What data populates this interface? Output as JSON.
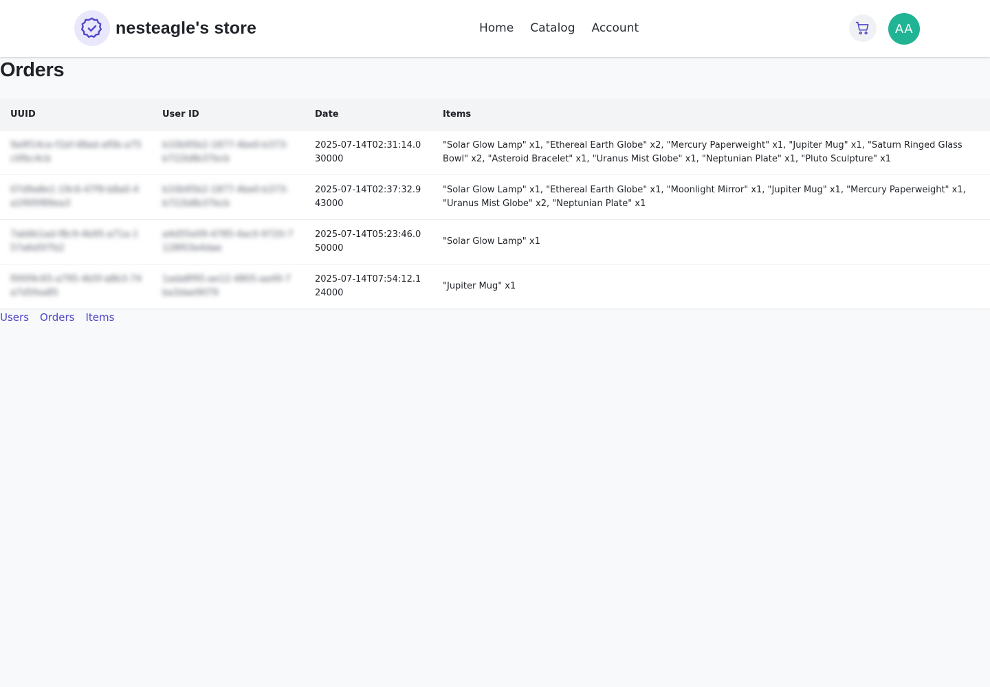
{
  "header": {
    "store_name": "nesteagle's store",
    "nav": [
      {
        "label": "Home"
      },
      {
        "label": "Catalog"
      },
      {
        "label": "Account"
      }
    ],
    "avatar_initials": "AA",
    "icons": {
      "logo": "verified-badge-icon",
      "cart": "cart-icon"
    },
    "colors": {
      "accent": "#4f46c9",
      "avatar_bg": "#20b494"
    }
  },
  "page": {
    "title": "Orders"
  },
  "table": {
    "columns": [
      "UUID",
      "User ID",
      "Date",
      "Items"
    ],
    "rows": [
      {
        "uuid": "9a9f14ce-f1bf-48ad-af0b-a75c0fbc4cb",
        "user_id": "b10b95b2-1877-4be0-b373-b722b8b37bcb",
        "date": "2025-07-14T02:31:14.030000",
        "items": "\"Solar Glow Lamp\" x1, \"Ethereal Earth Globe\" x2, \"Mercury Paperweight\" x1, \"Jupiter Mug\" x1, \"Saturn Ringed Glass Bowl\" x2, \"Asteroid Bracelet\" x1, \"Uranus Mist Globe\" x1, \"Neptunian Plate\" x1, \"Pluto Sculpture\" x1"
      },
      {
        "uuid": "07d9a8e1-19c6-47f9-b8a0-4a1f6f0f89ea3",
        "user_id": "b10b95b2-1877-4be0-b373-b722b8b37bcb",
        "date": "2025-07-14T02:37:32.943000",
        "items": "\"Solar Glow Lamp\" x1, \"Ethereal Earth Globe\" x1, \"Moonlight Mirror\" x1, \"Jupiter Mug\" x1, \"Mercury Paperweight\" x1, \"Uranus Mist Globe\" x2, \"Neptunian Plate\" x1"
      },
      {
        "uuid": "7ab6b1ad-f8c9-4b95-a71a-157a6d5f7b2",
        "user_id": "a4d55e09-4785-4ac0-9720-7128f03e4dae",
        "date": "2025-07-14T05:23:46.050000",
        "items": "\"Solar Glow Lamp\" x1"
      },
      {
        "uuid": "f0009c65-a795-4b5f-a8b3-74a7d5fea85",
        "user_id": "1ada8f95-ae12-4805-aa49-7ba3dae9079",
        "date": "2025-07-14T07:54:12.124000",
        "items": "\"Jupiter Mug\" x1"
      }
    ]
  },
  "footer": {
    "links": [
      {
        "label": "Users"
      },
      {
        "label": "Orders"
      },
      {
        "label": "Items"
      }
    ]
  }
}
